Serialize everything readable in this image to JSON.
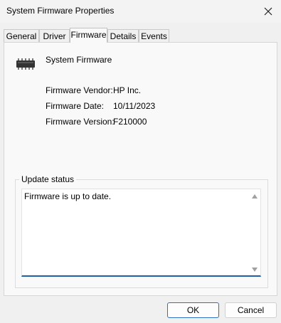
{
  "window": {
    "title": "System Firmware Properties"
  },
  "tabs": [
    {
      "label": "General"
    },
    {
      "label": "Driver"
    },
    {
      "label": "Firmware",
      "active": true
    },
    {
      "label": "Details"
    },
    {
      "label": "Events"
    }
  ],
  "firmware": {
    "device_name": "System Firmware",
    "vendor_label": "Firmware Vendor:",
    "vendor_value": "HP Inc.",
    "date_label": "Firmware Date:",
    "date_value": "10/11/2023",
    "version_label": "Firmware Version:",
    "version_value": "F210000"
  },
  "update_status": {
    "label": "Update status",
    "text": "Firmware is up to date."
  },
  "buttons": {
    "ok": "OK",
    "cancel": "Cancel"
  },
  "icons": {
    "close": "close-icon",
    "device": "chip-icon",
    "scroll_up": "scroll-up-arrow-icon",
    "scroll_down": "scroll-down-arrow-icon"
  },
  "colors": {
    "accent": "#1e5fa8",
    "primary_button_border": "#2f6fbf"
  }
}
